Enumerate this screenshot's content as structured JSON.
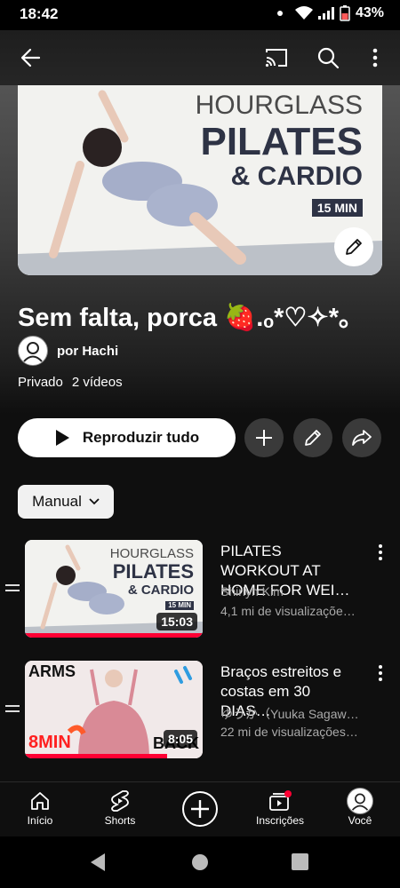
{
  "status_bar": {
    "time": "18:42",
    "battery": "43%"
  },
  "header": {
    "back_icon": "arrow-left-icon",
    "cast_icon": "cast-icon",
    "search_icon": "search-icon",
    "more_icon": "more-vert-icon"
  },
  "hero": {
    "thumb_line1": "HOURGLASS",
    "thumb_line2": "PILATES",
    "thumb_line3": "& CARDIO",
    "thumb_badge": "15 MIN"
  },
  "playlist": {
    "title": "Sem falta, porca 🍓.ₒ*♡✧*｡",
    "owner": "por Hachi",
    "privacy": "Privado",
    "count": "2 vídeos"
  },
  "actions": {
    "play_all": "Reproduzir tudo",
    "sort": "Manual"
  },
  "videos": [
    {
      "title": "PILATES WORKOUT AT HOME FOR WEI…",
      "channel": "Shirlyn Kim",
      "views": "4,1 mi de visualizaçõe…",
      "duration": "15:03",
      "thumb_line1": "HOURGLASS",
      "thumb_line2": "PILATES",
      "thumb_line3": "& CARDIO",
      "thumb_badge": "15 MIN",
      "progress": 1.0
    },
    {
      "title": "Braços estreitos e costas em 30 DIAS…",
      "channel": "ゆうか（Yuuka Sagaw…",
      "views": "22 mi de visualizações…",
      "duration": "8:05",
      "thumb_arms": "ARMS",
      "thumb_min": "8MIN",
      "thumb_back": "BACK",
      "progress": 0.8
    }
  ],
  "bottom_nav": [
    {
      "label": "Início"
    },
    {
      "label": "Shorts"
    },
    {
      "label": ""
    },
    {
      "label": "Inscrições"
    },
    {
      "label": "Você"
    }
  ],
  "colors": {
    "accent": "#ff0033",
    "background": "#0f0f0f"
  }
}
